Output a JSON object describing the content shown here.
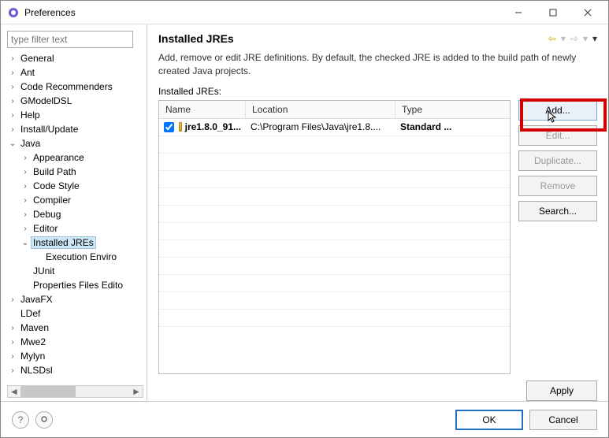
{
  "window": {
    "title": "Preferences"
  },
  "sidebar": {
    "filter_placeholder": "type filter text",
    "items": [
      {
        "label": "General",
        "exp": false
      },
      {
        "label": "Ant",
        "exp": false
      },
      {
        "label": "Code Recommenders",
        "exp": false
      },
      {
        "label": "GModelDSL",
        "exp": false
      },
      {
        "label": "Help",
        "exp": false
      },
      {
        "label": "Install/Update",
        "exp": false
      },
      {
        "label": "Java",
        "exp": true,
        "children": [
          {
            "label": "Appearance",
            "exp": false
          },
          {
            "label": "Build Path",
            "exp": false
          },
          {
            "label": "Code Style",
            "exp": false
          },
          {
            "label": "Compiler",
            "exp": false
          },
          {
            "label": "Debug",
            "exp": false
          },
          {
            "label": "Editor",
            "exp": false
          },
          {
            "label": "Installed JREs",
            "exp": true,
            "selected": true,
            "children": [
              {
                "label": "Execution Enviro"
              }
            ]
          },
          {
            "label": "JUnit"
          },
          {
            "label": "Properties Files Edito"
          }
        ]
      },
      {
        "label": "JavaFX",
        "exp": false
      },
      {
        "label": "LDef"
      },
      {
        "label": "Maven",
        "exp": false
      },
      {
        "label": "Mwe2",
        "exp": false
      },
      {
        "label": "Mylyn",
        "exp": false
      },
      {
        "label": "NLSDsl",
        "exp": false
      }
    ]
  },
  "main": {
    "heading": "Installed JREs",
    "description": "Add, remove or edit JRE definitions. By default, the checked JRE is added to the build path of newly created Java projects.",
    "table_label": "Installed JREs:",
    "columns": {
      "name": "Name",
      "location": "Location",
      "type": "Type"
    },
    "rows": [
      {
        "checked": true,
        "name": "jre1.8.0_91...",
        "location": "C:\\Program Files\\Java\\jre1.8....",
        "type": "Standard ..."
      }
    ],
    "buttons": {
      "add": "Add...",
      "edit": "Edit...",
      "duplicate": "Duplicate...",
      "remove": "Remove",
      "search": "Search..."
    },
    "apply": "Apply"
  },
  "bottom": {
    "ok": "OK",
    "cancel": "Cancel"
  }
}
